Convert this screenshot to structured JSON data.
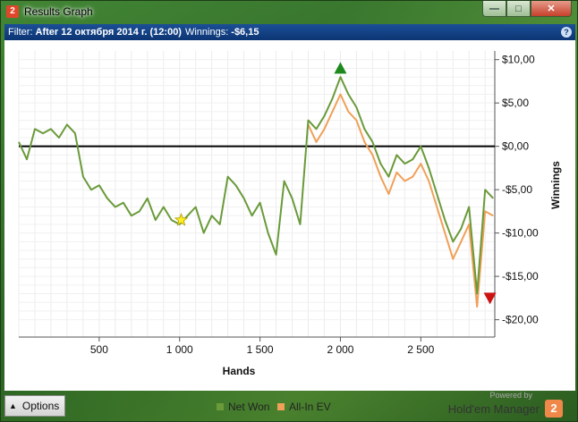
{
  "window": {
    "title": "Results Graph",
    "app_icon": "2",
    "controls": {
      "minimize": "—",
      "maximize": "□",
      "close": "✕"
    }
  },
  "filter_bar": {
    "prefix": "Filter:",
    "filter": "After 12 октября 2014 г. (12:00)",
    "winnings_label": "Winnings:",
    "winnings_value": "-$6,15",
    "help_icon": "?"
  },
  "chart_data": {
    "type": "line",
    "xlabel": "Hands",
    "ylabel": "Winnings",
    "xlim": [
      0,
      2960
    ],
    "ylim": [
      -22,
      11
    ],
    "x_ticks": [
      500,
      1000,
      1500,
      2000,
      2500
    ],
    "x_tick_labels": [
      "500",
      "1 000",
      "1 500",
      "2 000",
      "2 500"
    ],
    "y_ticks": [
      10,
      5,
      0,
      -5,
      -10,
      -15,
      -20
    ],
    "y_tick_labels": [
      "$10,00",
      "$5,00",
      "$0,00",
      "-$5,00",
      "-$10,00",
      "-$15,00",
      "-$20,00"
    ],
    "grid": true,
    "zero_line": true,
    "series": [
      {
        "name": "Net Won",
        "color": "#6a9a3a",
        "x": [
          0,
          50,
          100,
          150,
          200,
          250,
          300,
          350,
          400,
          450,
          500,
          550,
          600,
          650,
          700,
          750,
          800,
          850,
          900,
          950,
          1000,
          1050,
          1100,
          1150,
          1200,
          1250,
          1300,
          1350,
          1400,
          1450,
          1500,
          1550,
          1600,
          1650,
          1700,
          1750,
          1800,
          1850,
          1900,
          1950,
          2000,
          2050,
          2100,
          2150,
          2200,
          2250,
          2300,
          2350,
          2400,
          2450,
          2500,
          2550,
          2600,
          2650,
          2700,
          2750,
          2800,
          2850,
          2900,
          2950
        ],
        "values": [
          0.5,
          -1.5,
          2.0,
          1.5,
          2.0,
          1.0,
          2.5,
          1.5,
          -3.5,
          -5.0,
          -4.5,
          -6.0,
          -7.0,
          -6.5,
          -8.0,
          -7.5,
          -6.0,
          -8.5,
          -7.0,
          -8.5,
          -9.0,
          -8.0,
          -7.0,
          -10.0,
          -8.0,
          -9.0,
          -3.5,
          -4.5,
          -6.0,
          -8.0,
          -6.5,
          -10.0,
          -12.5,
          -4.0,
          -6.0,
          -9.0,
          3.0,
          2.0,
          3.5,
          5.5,
          8.0,
          6.0,
          4.5,
          2.0,
          0.5,
          -2.0,
          -3.5,
          -1.0,
          -2.0,
          -1.5,
          0.0,
          -2.5,
          -5.5,
          -8.5,
          -11.0,
          -9.5,
          -7.0,
          -17.0,
          -5.0,
          -6.0
        ]
      },
      {
        "name": "All-In EV",
        "color": "#f0a058",
        "x": [
          1800,
          1850,
          1900,
          1950,
          2000,
          2050,
          2100,
          2150,
          2200,
          2250,
          2300,
          2350,
          2400,
          2450,
          2500,
          2550,
          2600,
          2650,
          2700,
          2750,
          2800,
          2850,
          2900,
          2950
        ],
        "values": [
          2.5,
          0.5,
          2.0,
          4.0,
          6.0,
          4.0,
          3.0,
          0.5,
          -1.0,
          -3.5,
          -5.5,
          -3.0,
          -4.0,
          -3.5,
          -2.0,
          -4.0,
          -7.0,
          -10.0,
          -13.0,
          -11.0,
          -9.0,
          -18.5,
          -7.5,
          -8.0
        ]
      }
    ],
    "markers": [
      {
        "type": "star",
        "x": 1010,
        "y": -8.5,
        "color": "#ffee22"
      },
      {
        "type": "triangle-up",
        "x": 2000,
        "y": 9.0,
        "color": "#1e8a1e"
      },
      {
        "type": "triangle-down",
        "x": 2930,
        "y": -17.5,
        "color": "#cc1111"
      }
    ]
  },
  "legend": {
    "items": [
      {
        "label": "Net Won",
        "color": "#6a9a3a"
      },
      {
        "label": "All-In EV",
        "color": "#f0a058"
      }
    ]
  },
  "footer": {
    "options_label": "Options",
    "powered_by": "Powered by",
    "brand_name": "Hold'em Manager",
    "brand_logo": "2"
  }
}
